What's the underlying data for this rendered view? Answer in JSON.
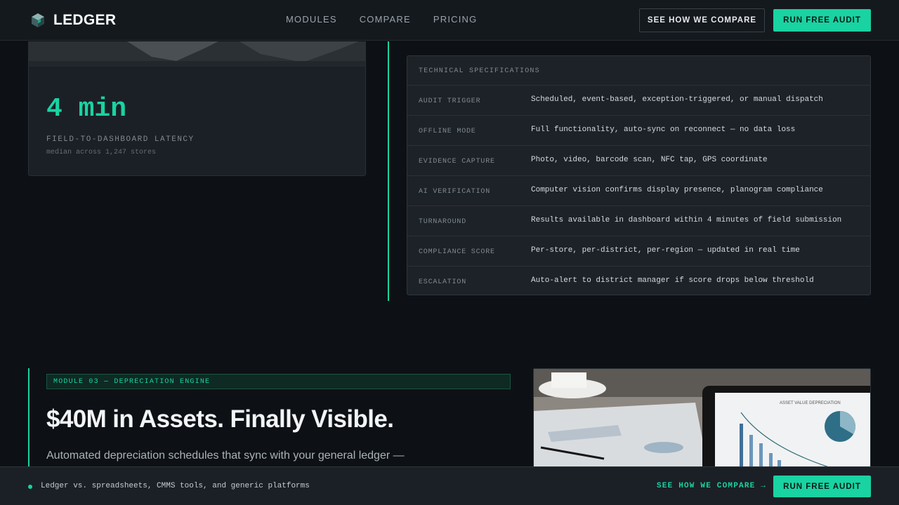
{
  "brand": {
    "name": "LEDGER"
  },
  "nav": {
    "links": [
      "MODULES",
      "COMPARE",
      "PRICING"
    ],
    "compare_button": "SEE HOW WE COMPARE",
    "cta_button": "RUN FREE AUDIT"
  },
  "stat_card": {
    "value": "4 min",
    "label": "FIELD-TO-DASHBOARD LATENCY",
    "sub": "median across 1,247 stores"
  },
  "specs": {
    "heading": "TECHNICAL SPECIFICATIONS",
    "rows": [
      {
        "key": "AUDIT TRIGGER",
        "value": "Scheduled, event-based, exception-triggered, or manual dispatch"
      },
      {
        "key": "OFFLINE MODE",
        "value": "Full functionality, auto-sync on reconnect — no data loss"
      },
      {
        "key": "EVIDENCE CAPTURE",
        "value": "Photo, video, barcode scan, NFC tap, GPS coordinate"
      },
      {
        "key": "AI VERIFICATION",
        "value": "Computer vision confirms display presence, planogram compliance"
      },
      {
        "key": "TURNAROUND",
        "value": "Results available in dashboard within 4 minutes of field submission"
      },
      {
        "key": "COMPLIANCE SCORE",
        "value": "Per-store, per-district, per-region — updated in real time"
      },
      {
        "key": "ESCALATION",
        "value": "Auto-alert to district manager if score drops below threshold"
      }
    ]
  },
  "module": {
    "tag": "MODULE 03 — DEPRECIATION ENGINE",
    "title": "$40M in Assets. Finally Visible.",
    "description": "Automated depreciation schedules that sync with your general ledger —",
    "image_chart_title": "ASSET VALUE DEPRECIATION"
  },
  "bottom_bar": {
    "text": "Ledger vs. spreadsheets, CMMS tools, and generic platforms",
    "link": "SEE HOW WE COMPARE →",
    "cta_button": "RUN FREE AUDIT"
  },
  "colors": {
    "accent": "#19d3a2",
    "background": "#0d1115",
    "panel": "#1d2228"
  }
}
